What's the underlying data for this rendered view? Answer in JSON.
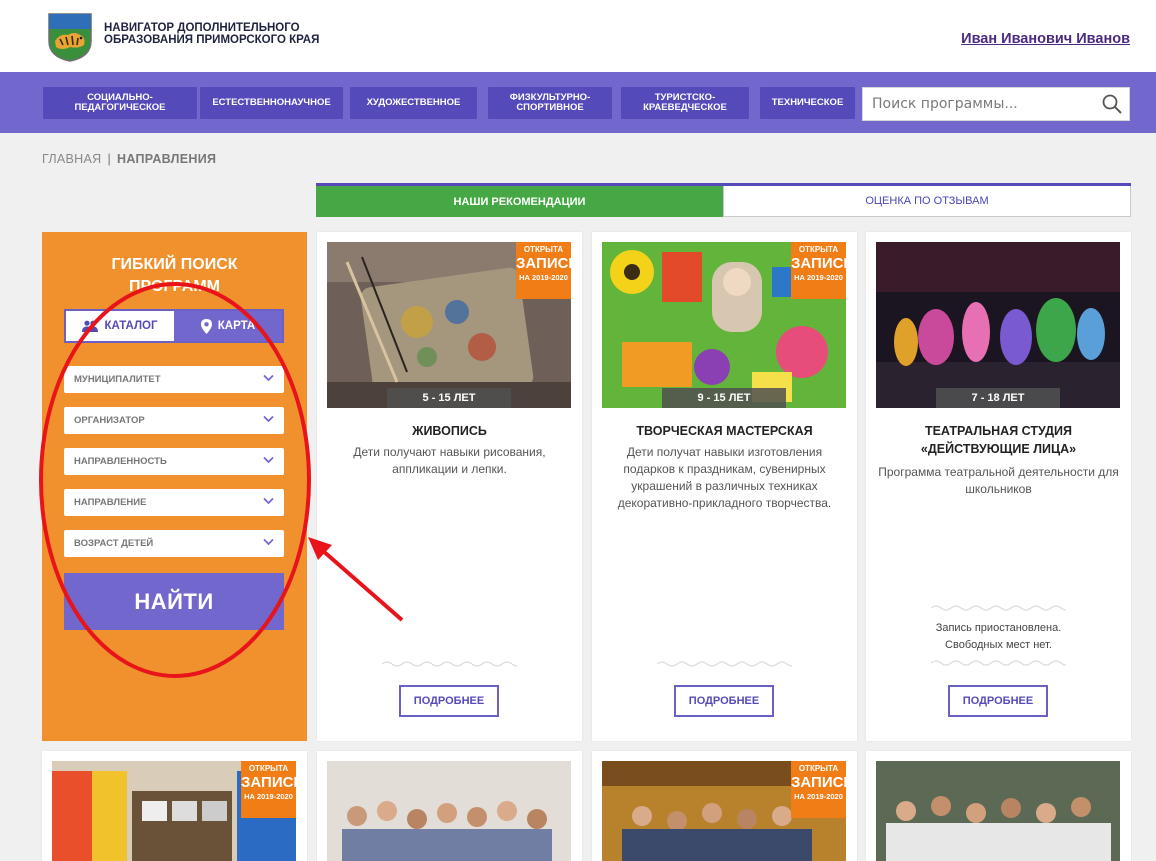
{
  "header": {
    "logo_line1": "НАВИГАТОР ДОПОЛНИТЕЛЬНОГО",
    "logo_line2": "ОБРАЗОВАНИЯ ПРИМОРСКОГО КРАЯ",
    "user_name": "Иван Иванович Иванов"
  },
  "nav": {
    "items": [
      {
        "line1": "СОЦИАЛЬНО-",
        "line2": "ПЕДАГОГИЧЕСКОЕ"
      },
      {
        "line1": "ЕСТЕСТВЕННОНАУЧНОЕ",
        "line2": ""
      },
      {
        "line1": "ХУДОЖЕСТВЕННОЕ",
        "line2": ""
      },
      {
        "line1": "ФИЗКУЛЬТУРНО-",
        "line2": "СПОРТИВНОЕ"
      },
      {
        "line1": "ТУРИСТСКО-",
        "line2": "КРАЕВЕДЧЕСКОЕ"
      },
      {
        "line1": "ТЕХНИЧЕСКОЕ",
        "line2": ""
      }
    ],
    "search_placeholder": "Поиск программы..."
  },
  "breadcrumb": {
    "home": "ГЛАВНАЯ",
    "separator": "|",
    "current": "НАПРАВЛЕНИЯ"
  },
  "tabs": {
    "active": "НАШИ РЕКОМЕНДАЦИИ",
    "other": "ОЦЕНКА ПО ОТЗЫВАМ"
  },
  "sidebar": {
    "title_line1": "ГИБКИЙ ПОИСК",
    "title_line2": "ПРОГРАММ",
    "toggle_catalog": "КАТАЛОГ",
    "toggle_map": "КАРТА",
    "filters": [
      "МУНИЦИПАЛИТЕТ",
      "ОРГАНИЗАТОР",
      "НАПРАВЛЕННОСТЬ",
      "НАПРАВЛЕНИЕ",
      "ВОЗРАСТ ДЕТЕЙ"
    ],
    "find_button": "НАЙТИ"
  },
  "badge": {
    "line1": "ОТКРЫТА",
    "line2": "ЗАПИСЬ",
    "line3": "НА 2019-2020"
  },
  "cards": [
    {
      "age": "5 - 15 ЛЕТ",
      "title_line1": "ЖИВОПИСЬ",
      "title_line2": "",
      "desc": "Дети получают навыки рисования, аппликации и лепки.",
      "status_line1": "",
      "status_line2": "",
      "more": "ПОДРОБНЕЕ"
    },
    {
      "age": "9 - 15 ЛЕТ",
      "title_line1": "ТВОРЧЕСКАЯ МАСТЕРСКАЯ",
      "title_line2": "",
      "desc": "Дети получат навыки изготовления подарков к праздникам, сувенирных украшений в различных техниках декоративно-прикладного творчества.",
      "status_line1": "",
      "status_line2": "",
      "more": "ПОДРОБНЕЕ"
    },
    {
      "age": "7 - 18 ЛЕТ",
      "title_line1": "ТЕАТРАЛЬНАЯ СТУДИЯ",
      "title_line2": "«ДЕЙСТВУЮЩИЕ ЛИЦА»",
      "desc": "Программа театральной деятельности для школьников",
      "status_line1": "Запись приостановлена.",
      "status_line2": "Свободных мест нет.",
      "more": "ПОДРОБНЕЕ"
    }
  ],
  "colors": {
    "nav_bg": "#7167cc",
    "nav_btn": "#544aba",
    "sidebar_bg": "#f0912e",
    "tab_active": "#45a845",
    "badge": "#f07d16",
    "annotation": "#e8141a"
  }
}
